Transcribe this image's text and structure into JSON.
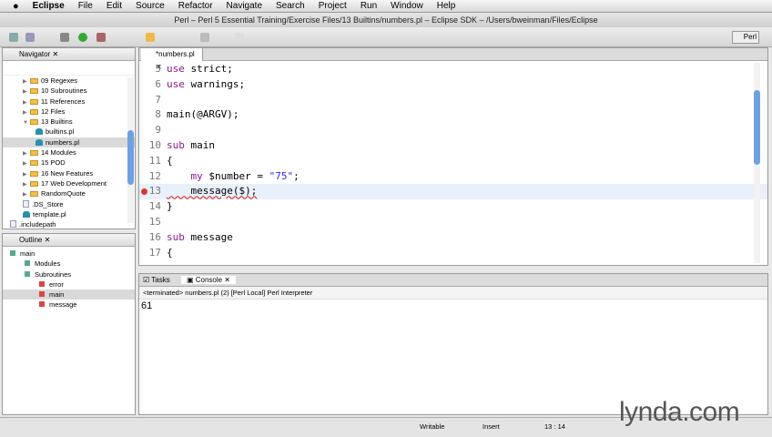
{
  "menubar": {
    "app": "Eclipse",
    "items": [
      "File",
      "Edit",
      "Source",
      "Refactor",
      "Navigate",
      "Search",
      "Project",
      "Run",
      "Window",
      "Help"
    ]
  },
  "window_title": "Perl – Perl 5 Essential Training/Exercise Files/13 Builtins/numbers.pl – Eclipse SDK – /Users/bweinman/Files/Eclipse",
  "perspective": "Perl",
  "navigator": {
    "title": "Navigator",
    "items": [
      {
        "label": "09 Regexes",
        "type": "folder",
        "level": 1
      },
      {
        "label": "10 Subroutines",
        "type": "folder",
        "level": 1
      },
      {
        "label": "11 References",
        "type": "folder",
        "level": 1
      },
      {
        "label": "12 Files",
        "type": "folder",
        "level": 1
      },
      {
        "label": "13 Builtins",
        "type": "folder",
        "level": 1,
        "open": true
      },
      {
        "label": "builtins.pl",
        "type": "perl",
        "level": 2
      },
      {
        "label": "numbers.pl",
        "type": "perl",
        "level": 2,
        "selected": true
      },
      {
        "label": "14 Modules",
        "type": "folder",
        "level": 1
      },
      {
        "label": "15 POD",
        "type": "folder",
        "level": 1
      },
      {
        "label": "16 New Features",
        "type": "folder",
        "level": 1
      },
      {
        "label": "17 Web Development",
        "type": "folder",
        "level": 1
      },
      {
        "label": "RandomQuote",
        "type": "folder",
        "level": 1
      },
      {
        "label": ".DS_Store",
        "type": "file",
        "level": 1
      },
      {
        "label": "template.pl",
        "type": "perl",
        "level": 1
      },
      {
        "label": ".includepath",
        "type": "file",
        "level": 0
      }
    ]
  },
  "outline": {
    "title": "Outline",
    "items": [
      {
        "label": "main",
        "level": 0
      },
      {
        "label": "Modules",
        "level": 1
      },
      {
        "label": "Subroutines",
        "level": 1
      },
      {
        "label": "error",
        "level": 2
      },
      {
        "label": "main",
        "level": 2,
        "selected": true
      },
      {
        "label": "message",
        "level": 2
      }
    ]
  },
  "editor": {
    "tab": "*numbers.pl",
    "lines": [
      {
        "n": "5",
        "html": "<span class='kw'>use</span> strict;"
      },
      {
        "n": "6",
        "html": "<span class='kw'>use</span> warnings;"
      },
      {
        "n": "7",
        "html": ""
      },
      {
        "n": "8",
        "html": "main(@ARGV);"
      },
      {
        "n": "9",
        "html": ""
      },
      {
        "n": "10",
        "html": "<span class='kw'>sub</span> main"
      },
      {
        "n": "11",
        "html": "{"
      },
      {
        "n": "12",
        "html": "    <span class='kw'>my</span> $number = <span class='str'>\"75\"</span>;"
      },
      {
        "n": "13",
        "html": "    message($);",
        "error": true
      },
      {
        "n": "14",
        "html": "}"
      },
      {
        "n": "15",
        "html": ""
      },
      {
        "n": "16",
        "html": "<span class='kw'>sub</span> message"
      },
      {
        "n": "17",
        "html": "{"
      }
    ]
  },
  "console": {
    "tabs": [
      "Tasks",
      "Console"
    ],
    "header": "<terminated> numbers.pl (2) [Perl Local] Perl Interpreter",
    "output": "61"
  },
  "status": {
    "mode": "Writable",
    "insert": "Insert",
    "position": "13 : 14"
  },
  "watermark": "lynda.com"
}
